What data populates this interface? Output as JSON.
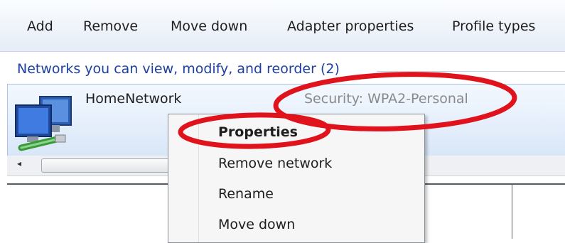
{
  "toolbar": {
    "buttons": [
      "Add",
      "Remove",
      "Move down",
      "Adapter properties",
      "Profile types"
    ]
  },
  "group": {
    "label": "Networks you can view, modify, and reorder (2)"
  },
  "network": {
    "name": "HomeNetwork",
    "security": "Security:  WPA2-Personal"
  },
  "context_menu": {
    "items": [
      "Properties",
      "Remove network",
      "Rename",
      "Move down"
    ]
  },
  "scrollbar": {
    "left_arrow": "◂"
  },
  "colors": {
    "group_label": "#1c3fa0",
    "annotation_red": "#e0121b",
    "row_highlight": "#e4eefb"
  }
}
